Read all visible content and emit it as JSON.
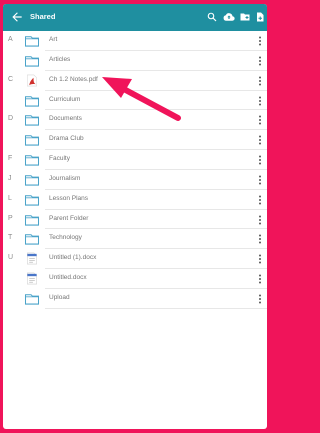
{
  "appbar": {
    "title": "Shared"
  },
  "colors": {
    "accent": "#1f8fa0",
    "frame": "#f0145a",
    "folder": "#4aa3c9",
    "annotation_arrow": "#f0145a"
  },
  "files": [
    {
      "letter": "A",
      "name": "Art",
      "icon": "folder-icon"
    },
    {
      "letter": "",
      "name": "Articles",
      "icon": "folder-icon"
    },
    {
      "letter": "C",
      "name": "Ch 1.2 Notes.pdf",
      "icon": "pdf-file-icon"
    },
    {
      "letter": "",
      "name": "Curriculum",
      "icon": "folder-icon"
    },
    {
      "letter": "D",
      "name": "Documents",
      "icon": "folder-icon"
    },
    {
      "letter": "",
      "name": "Drama Club",
      "icon": "folder-icon"
    },
    {
      "letter": "F",
      "name": "Faculty",
      "icon": "folder-icon"
    },
    {
      "letter": "J",
      "name": "Journalism",
      "icon": "folder-icon"
    },
    {
      "letter": "L",
      "name": "Lesson Plans",
      "icon": "folder-icon"
    },
    {
      "letter": "P",
      "name": "Parent Folder",
      "icon": "folder-icon"
    },
    {
      "letter": "T",
      "name": "Technology",
      "icon": "folder-icon"
    },
    {
      "letter": "U",
      "name": "Untitled (1).docx",
      "icon": "docx-file-icon"
    },
    {
      "letter": "",
      "name": "Untitled.docx",
      "icon": "docx-file-icon"
    },
    {
      "letter": "",
      "name": "Upload",
      "icon": "folder-icon"
    }
  ]
}
